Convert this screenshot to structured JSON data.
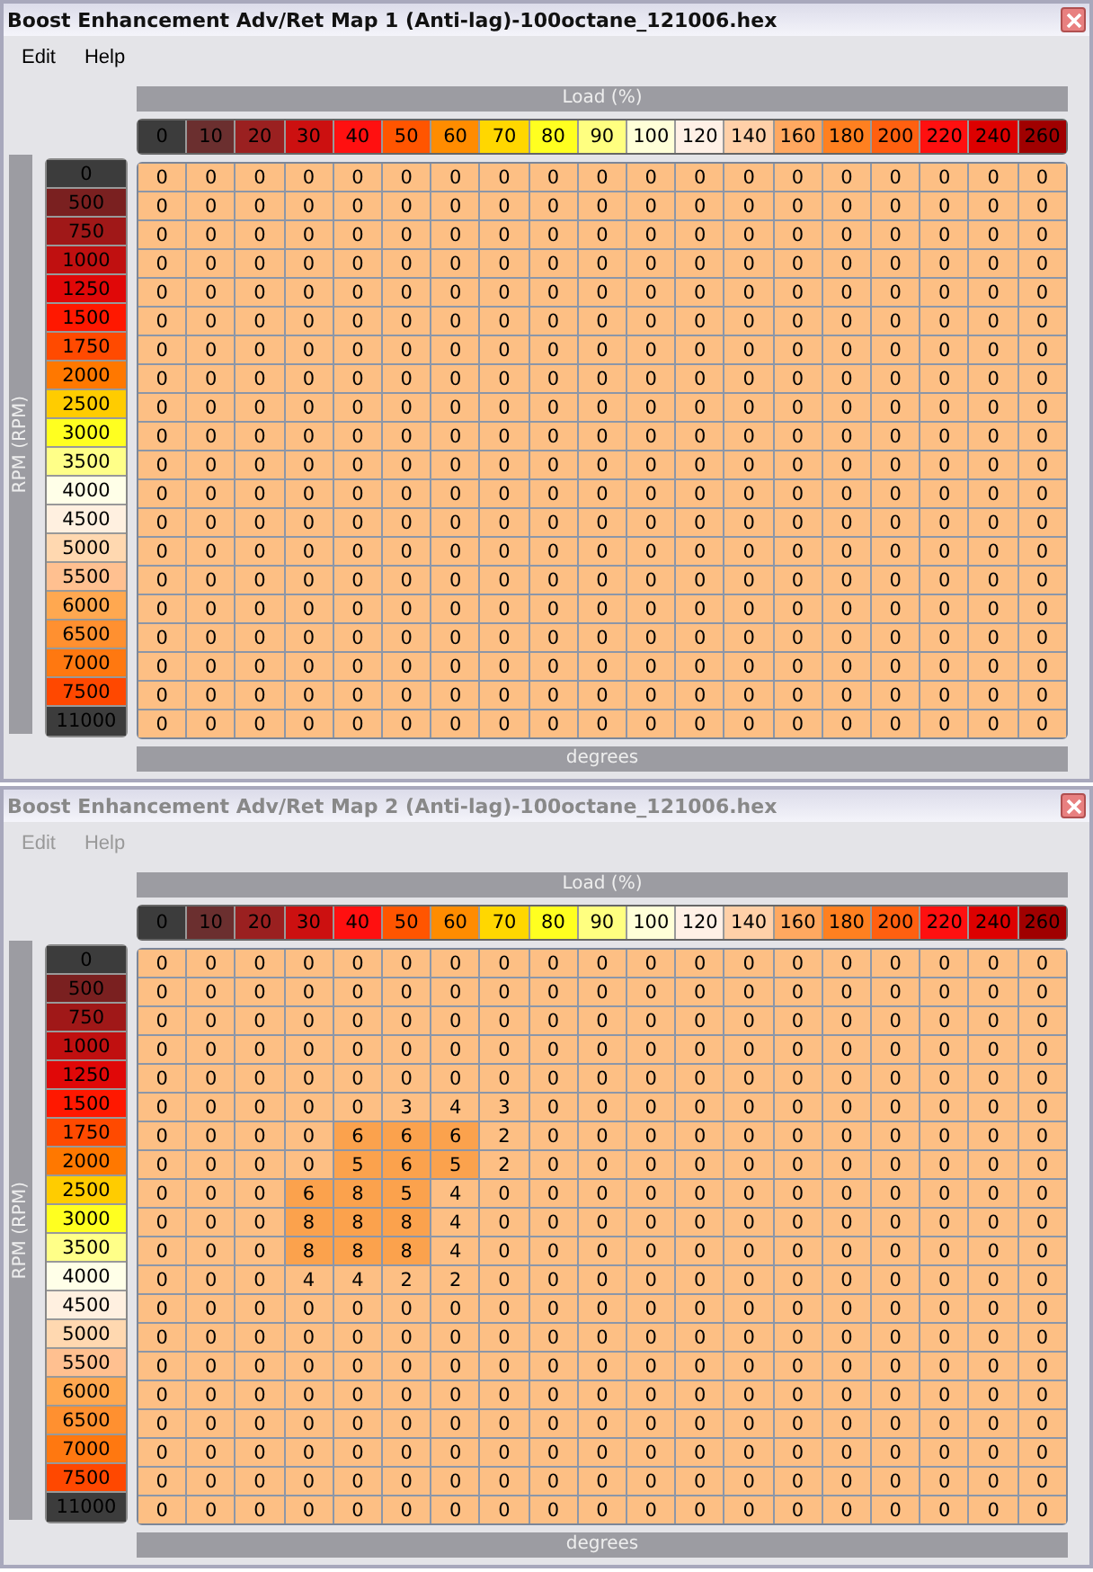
{
  "windows": [
    {
      "title": "Boost Enhancement Adv/Ret Map 1 (Anti-lag)-100octane_121006.hex",
      "active": true,
      "menu": [
        "Edit",
        "Help"
      ],
      "x_axis_title": "Load (%)",
      "y_axis_title": "RPM (RPM)",
      "footer": "degrees",
      "columns": [
        {
          "label": "0",
          "color": "#3c3c3c"
        },
        {
          "label": "10",
          "color": "#6b2f2f"
        },
        {
          "label": "20",
          "color": "#9a2020"
        },
        {
          "label": "30",
          "color": "#cc1010"
        },
        {
          "label": "40",
          "color": "#ff1010"
        },
        {
          "label": "50",
          "color": "#ff5500"
        },
        {
          "label": "60",
          "color": "#ff8c00"
        },
        {
          "label": "70",
          "color": "#ffd700"
        },
        {
          "label": "80",
          "color": "#ffff20"
        },
        {
          "label": "90",
          "color": "#ffff80"
        },
        {
          "label": "100",
          "color": "#ffffd8"
        },
        {
          "label": "120",
          "color": "#fff0e6"
        },
        {
          "label": "140",
          "color": "#ffd0a8"
        },
        {
          "label": "160",
          "color": "#ffa860"
        },
        {
          "label": "180",
          "color": "#ff8020"
        },
        {
          "label": "200",
          "color": "#ff6010"
        },
        {
          "label": "220",
          "color": "#ff1010"
        },
        {
          "label": "240",
          "color": "#dd0000"
        },
        {
          "label": "260",
          "color": "#a00000"
        }
      ],
      "rows": [
        {
          "label": "0",
          "color": "#3c3c3c",
          "cells": [
            "0",
            "0",
            "0",
            "0",
            "0",
            "0",
            "0",
            "0",
            "0",
            "0",
            "0",
            "0",
            "0",
            "0",
            "0",
            "0",
            "0",
            "0",
            "0"
          ]
        },
        {
          "label": "500",
          "color": "#7a2020",
          "cells": [
            "0",
            "0",
            "0",
            "0",
            "0",
            "0",
            "0",
            "0",
            "0",
            "0",
            "0",
            "0",
            "0",
            "0",
            "0",
            "0",
            "0",
            "0",
            "0"
          ]
        },
        {
          "label": "750",
          "color": "#a01818",
          "cells": [
            "0",
            "0",
            "0",
            "0",
            "0",
            "0",
            "0",
            "0",
            "0",
            "0",
            "0",
            "0",
            "0",
            "0",
            "0",
            "0",
            "0",
            "0",
            "0"
          ]
        },
        {
          "label": "1000",
          "color": "#c01010",
          "cells": [
            "0",
            "0",
            "0",
            "0",
            "0",
            "0",
            "0",
            "0",
            "0",
            "0",
            "0",
            "0",
            "0",
            "0",
            "0",
            "0",
            "0",
            "0",
            "0"
          ]
        },
        {
          "label": "1250",
          "color": "#e00808",
          "cells": [
            "0",
            "0",
            "0",
            "0",
            "0",
            "0",
            "0",
            "0",
            "0",
            "0",
            "0",
            "0",
            "0",
            "0",
            "0",
            "0",
            "0",
            "0",
            "0"
          ]
        },
        {
          "label": "1500",
          "color": "#ff1800",
          "cells": [
            "0",
            "0",
            "0",
            "0",
            "0",
            "0",
            "0",
            "0",
            "0",
            "0",
            "0",
            "0",
            "0",
            "0",
            "0",
            "0",
            "0",
            "0",
            "0"
          ]
        },
        {
          "label": "1750",
          "color": "#ff4a00",
          "cells": [
            "0",
            "0",
            "0",
            "0",
            "0",
            "0",
            "0",
            "0",
            "0",
            "0",
            "0",
            "0",
            "0",
            "0",
            "0",
            "0",
            "0",
            "0",
            "0"
          ]
        },
        {
          "label": "2000",
          "color": "#ff7800",
          "cells": [
            "0",
            "0",
            "0",
            "0",
            "0",
            "0",
            "0",
            "0",
            "0",
            "0",
            "0",
            "0",
            "0",
            "0",
            "0",
            "0",
            "0",
            "0",
            "0"
          ]
        },
        {
          "label": "2500",
          "color": "#ffcc00",
          "cells": [
            "0",
            "0",
            "0",
            "0",
            "0",
            "0",
            "0",
            "0",
            "0",
            "0",
            "0",
            "0",
            "0",
            "0",
            "0",
            "0",
            "0",
            "0",
            "0"
          ]
        },
        {
          "label": "3000",
          "color": "#ffff20",
          "cells": [
            "0",
            "0",
            "0",
            "0",
            "0",
            "0",
            "0",
            "0",
            "0",
            "0",
            "0",
            "0",
            "0",
            "0",
            "0",
            "0",
            "0",
            "0",
            "0"
          ]
        },
        {
          "label": "3500",
          "color": "#ffff88",
          "cells": [
            "0",
            "0",
            "0",
            "0",
            "0",
            "0",
            "0",
            "0",
            "0",
            "0",
            "0",
            "0",
            "0",
            "0",
            "0",
            "0",
            "0",
            "0",
            "0"
          ]
        },
        {
          "label": "4000",
          "color": "#ffffe8",
          "cells": [
            "0",
            "0",
            "0",
            "0",
            "0",
            "0",
            "0",
            "0",
            "0",
            "0",
            "0",
            "0",
            "0",
            "0",
            "0",
            "0",
            "0",
            "0",
            "0"
          ]
        },
        {
          "label": "4500",
          "color": "#fff0e0",
          "cells": [
            "0",
            "0",
            "0",
            "0",
            "0",
            "0",
            "0",
            "0",
            "0",
            "0",
            "0",
            "0",
            "0",
            "0",
            "0",
            "0",
            "0",
            "0",
            "0"
          ]
        },
        {
          "label": "5000",
          "color": "#ffd8b0",
          "cells": [
            "0",
            "0",
            "0",
            "0",
            "0",
            "0",
            "0",
            "0",
            "0",
            "0",
            "0",
            "0",
            "0",
            "0",
            "0",
            "0",
            "0",
            "0",
            "0"
          ]
        },
        {
          "label": "5500",
          "color": "#ffc090",
          "cells": [
            "0",
            "0",
            "0",
            "0",
            "0",
            "0",
            "0",
            "0",
            "0",
            "0",
            "0",
            "0",
            "0",
            "0",
            "0",
            "0",
            "0",
            "0",
            "0"
          ]
        },
        {
          "label": "6000",
          "color": "#ffa850",
          "cells": [
            "0",
            "0",
            "0",
            "0",
            "0",
            "0",
            "0",
            "0",
            "0",
            "0",
            "0",
            "0",
            "0",
            "0",
            "0",
            "0",
            "0",
            "0",
            "0"
          ]
        },
        {
          "label": "6500",
          "color": "#ff9030",
          "cells": [
            "0",
            "0",
            "0",
            "0",
            "0",
            "0",
            "0",
            "0",
            "0",
            "0",
            "0",
            "0",
            "0",
            "0",
            "0",
            "0",
            "0",
            "0",
            "0"
          ]
        },
        {
          "label": "7000",
          "color": "#ff7810",
          "cells": [
            "0",
            "0",
            "0",
            "0",
            "0",
            "0",
            "0",
            "0",
            "0",
            "0",
            "0",
            "0",
            "0",
            "0",
            "0",
            "0",
            "0",
            "0",
            "0"
          ]
        },
        {
          "label": "7500",
          "color": "#ff4800",
          "cells": [
            "0",
            "0",
            "0",
            "0",
            "0",
            "0",
            "0",
            "0",
            "0",
            "0",
            "0",
            "0",
            "0",
            "0",
            "0",
            "0",
            "0",
            "0",
            "0"
          ]
        },
        {
          "label": "11000",
          "color": "#3c3c3c",
          "cells": [
            "0",
            "0",
            "0",
            "0",
            "0",
            "0",
            "0",
            "0",
            "0",
            "0",
            "0",
            "0",
            "0",
            "0",
            "0",
            "0",
            "0",
            "0",
            "0"
          ]
        }
      ]
    },
    {
      "title": "Boost Enhancement Adv/Ret Map 2 (Anti-lag)-100octane_121006.hex",
      "active": false,
      "menu": [
        "Edit",
        "Help"
      ],
      "x_axis_title": "Load (%)",
      "y_axis_title": "RPM (RPM)",
      "footer": "degrees",
      "columns": [
        {
          "label": "0",
          "color": "#3c3c3c"
        },
        {
          "label": "10",
          "color": "#6b2f2f"
        },
        {
          "label": "20",
          "color": "#9a2020"
        },
        {
          "label": "30",
          "color": "#cc1010"
        },
        {
          "label": "40",
          "color": "#ff1010"
        },
        {
          "label": "50",
          "color": "#ff5500"
        },
        {
          "label": "60",
          "color": "#ff8c00"
        },
        {
          "label": "70",
          "color": "#ffd700"
        },
        {
          "label": "80",
          "color": "#ffff20"
        },
        {
          "label": "90",
          "color": "#ffff80"
        },
        {
          "label": "100",
          "color": "#ffffd8"
        },
        {
          "label": "120",
          "color": "#fff0e6"
        },
        {
          "label": "140",
          "color": "#ffd0a8"
        },
        {
          "label": "160",
          "color": "#ffa860"
        },
        {
          "label": "180",
          "color": "#ff8020"
        },
        {
          "label": "200",
          "color": "#ff6010"
        },
        {
          "label": "220",
          "color": "#ff1010"
        },
        {
          "label": "240",
          "color": "#dd0000"
        },
        {
          "label": "260",
          "color": "#a00000"
        }
      ],
      "rows": [
        {
          "label": "0",
          "color": "#3c3c3c",
          "cells": [
            "0",
            "0",
            "0",
            "0",
            "0",
            "0",
            "0",
            "0",
            "0",
            "0",
            "0",
            "0",
            "0",
            "0",
            "0",
            "0",
            "0",
            "0",
            "0"
          ]
        },
        {
          "label": "500",
          "color": "#7a2020",
          "cells": [
            "0",
            "0",
            "0",
            "0",
            "0",
            "0",
            "0",
            "0",
            "0",
            "0",
            "0",
            "0",
            "0",
            "0",
            "0",
            "0",
            "0",
            "0",
            "0"
          ]
        },
        {
          "label": "750",
          "color": "#a01818",
          "cells": [
            "0",
            "0",
            "0",
            "0",
            "0",
            "0",
            "0",
            "0",
            "0",
            "0",
            "0",
            "0",
            "0",
            "0",
            "0",
            "0",
            "0",
            "0",
            "0"
          ]
        },
        {
          "label": "1000",
          "color": "#c01010",
          "cells": [
            "0",
            "0",
            "0",
            "0",
            "0",
            "0",
            "0",
            "0",
            "0",
            "0",
            "0",
            "0",
            "0",
            "0",
            "0",
            "0",
            "0",
            "0",
            "0"
          ]
        },
        {
          "label": "1250",
          "color": "#e00808",
          "cells": [
            "0",
            "0",
            "0",
            "0",
            "0",
            "0",
            "0",
            "0",
            "0",
            "0",
            "0",
            "0",
            "0",
            "0",
            "0",
            "0",
            "0",
            "0",
            "0"
          ]
        },
        {
          "label": "1500",
          "color": "#ff1800",
          "cells": [
            "0",
            "0",
            "0",
            "0",
            "0",
            "3",
            "4",
            "3",
            "0",
            "0",
            "0",
            "0",
            "0",
            "0",
            "0",
            "0",
            "0",
            "0",
            "0"
          ]
        },
        {
          "label": "1750",
          "color": "#ff4a00",
          "cells": [
            "0",
            "0",
            "0",
            "0",
            "6",
            "6",
            "6",
            "2",
            "0",
            "0",
            "0",
            "0",
            "0",
            "0",
            "0",
            "0",
            "0",
            "0",
            "0"
          ]
        },
        {
          "label": "2000",
          "color": "#ff7800",
          "cells": [
            "0",
            "0",
            "0",
            "0",
            "5",
            "6",
            "5",
            "2",
            "0",
            "0",
            "0",
            "0",
            "0",
            "0",
            "0",
            "0",
            "0",
            "0",
            "0"
          ]
        },
        {
          "label": "2500",
          "color": "#ffcc00",
          "cells": [
            "0",
            "0",
            "0",
            "6",
            "8",
            "5",
            "4",
            "0",
            "0",
            "0",
            "0",
            "0",
            "0",
            "0",
            "0",
            "0",
            "0",
            "0",
            "0"
          ]
        },
        {
          "label": "3000",
          "color": "#ffff20",
          "cells": [
            "0",
            "0",
            "0",
            "8",
            "8",
            "8",
            "4",
            "0",
            "0",
            "0",
            "0",
            "0",
            "0",
            "0",
            "0",
            "0",
            "0",
            "0",
            "0"
          ]
        },
        {
          "label": "3500",
          "color": "#ffff88",
          "cells": [
            "0",
            "0",
            "0",
            "8",
            "8",
            "8",
            "4",
            "0",
            "0",
            "0",
            "0",
            "0",
            "0",
            "0",
            "0",
            "0",
            "0",
            "0",
            "0"
          ]
        },
        {
          "label": "4000",
          "color": "#ffffe8",
          "cells": [
            "0",
            "0",
            "0",
            "4",
            "4",
            "2",
            "2",
            "0",
            "0",
            "0",
            "0",
            "0",
            "0",
            "0",
            "0",
            "0",
            "0",
            "0",
            "0"
          ]
        },
        {
          "label": "4500",
          "color": "#fff0e0",
          "cells": [
            "0",
            "0",
            "0",
            "0",
            "0",
            "0",
            "0",
            "0",
            "0",
            "0",
            "0",
            "0",
            "0",
            "0",
            "0",
            "0",
            "0",
            "0",
            "0"
          ]
        },
        {
          "label": "5000",
          "color": "#ffd8b0",
          "cells": [
            "0",
            "0",
            "0",
            "0",
            "0",
            "0",
            "0",
            "0",
            "0",
            "0",
            "0",
            "0",
            "0",
            "0",
            "0",
            "0",
            "0",
            "0",
            "0"
          ]
        },
        {
          "label": "5500",
          "color": "#ffc090",
          "cells": [
            "0",
            "0",
            "0",
            "0",
            "0",
            "0",
            "0",
            "0",
            "0",
            "0",
            "0",
            "0",
            "0",
            "0",
            "0",
            "0",
            "0",
            "0",
            "0"
          ]
        },
        {
          "label": "6000",
          "color": "#ffa850",
          "cells": [
            "0",
            "0",
            "0",
            "0",
            "0",
            "0",
            "0",
            "0",
            "0",
            "0",
            "0",
            "0",
            "0",
            "0",
            "0",
            "0",
            "0",
            "0",
            "0"
          ]
        },
        {
          "label": "6500",
          "color": "#ff9030",
          "cells": [
            "0",
            "0",
            "0",
            "0",
            "0",
            "0",
            "0",
            "0",
            "0",
            "0",
            "0",
            "0",
            "0",
            "0",
            "0",
            "0",
            "0",
            "0",
            "0"
          ]
        },
        {
          "label": "7000",
          "color": "#ff7810",
          "cells": [
            "0",
            "0",
            "0",
            "0",
            "0",
            "0",
            "0",
            "0",
            "0",
            "0",
            "0",
            "0",
            "0",
            "0",
            "0",
            "0",
            "0",
            "0",
            "0"
          ]
        },
        {
          "label": "7500",
          "color": "#ff4800",
          "cells": [
            "0",
            "0",
            "0",
            "0",
            "0",
            "0",
            "0",
            "0",
            "0",
            "0",
            "0",
            "0",
            "0",
            "0",
            "0",
            "0",
            "0",
            "0",
            "0"
          ]
        },
        {
          "label": "11000",
          "color": "#3c3c3c",
          "cells": [
            "0",
            "0",
            "0",
            "0",
            "0",
            "0",
            "0",
            "0",
            "0",
            "0",
            "0",
            "0",
            "0",
            "0",
            "0",
            "0",
            "0",
            "0",
            "0"
          ]
        }
      ]
    }
  ]
}
